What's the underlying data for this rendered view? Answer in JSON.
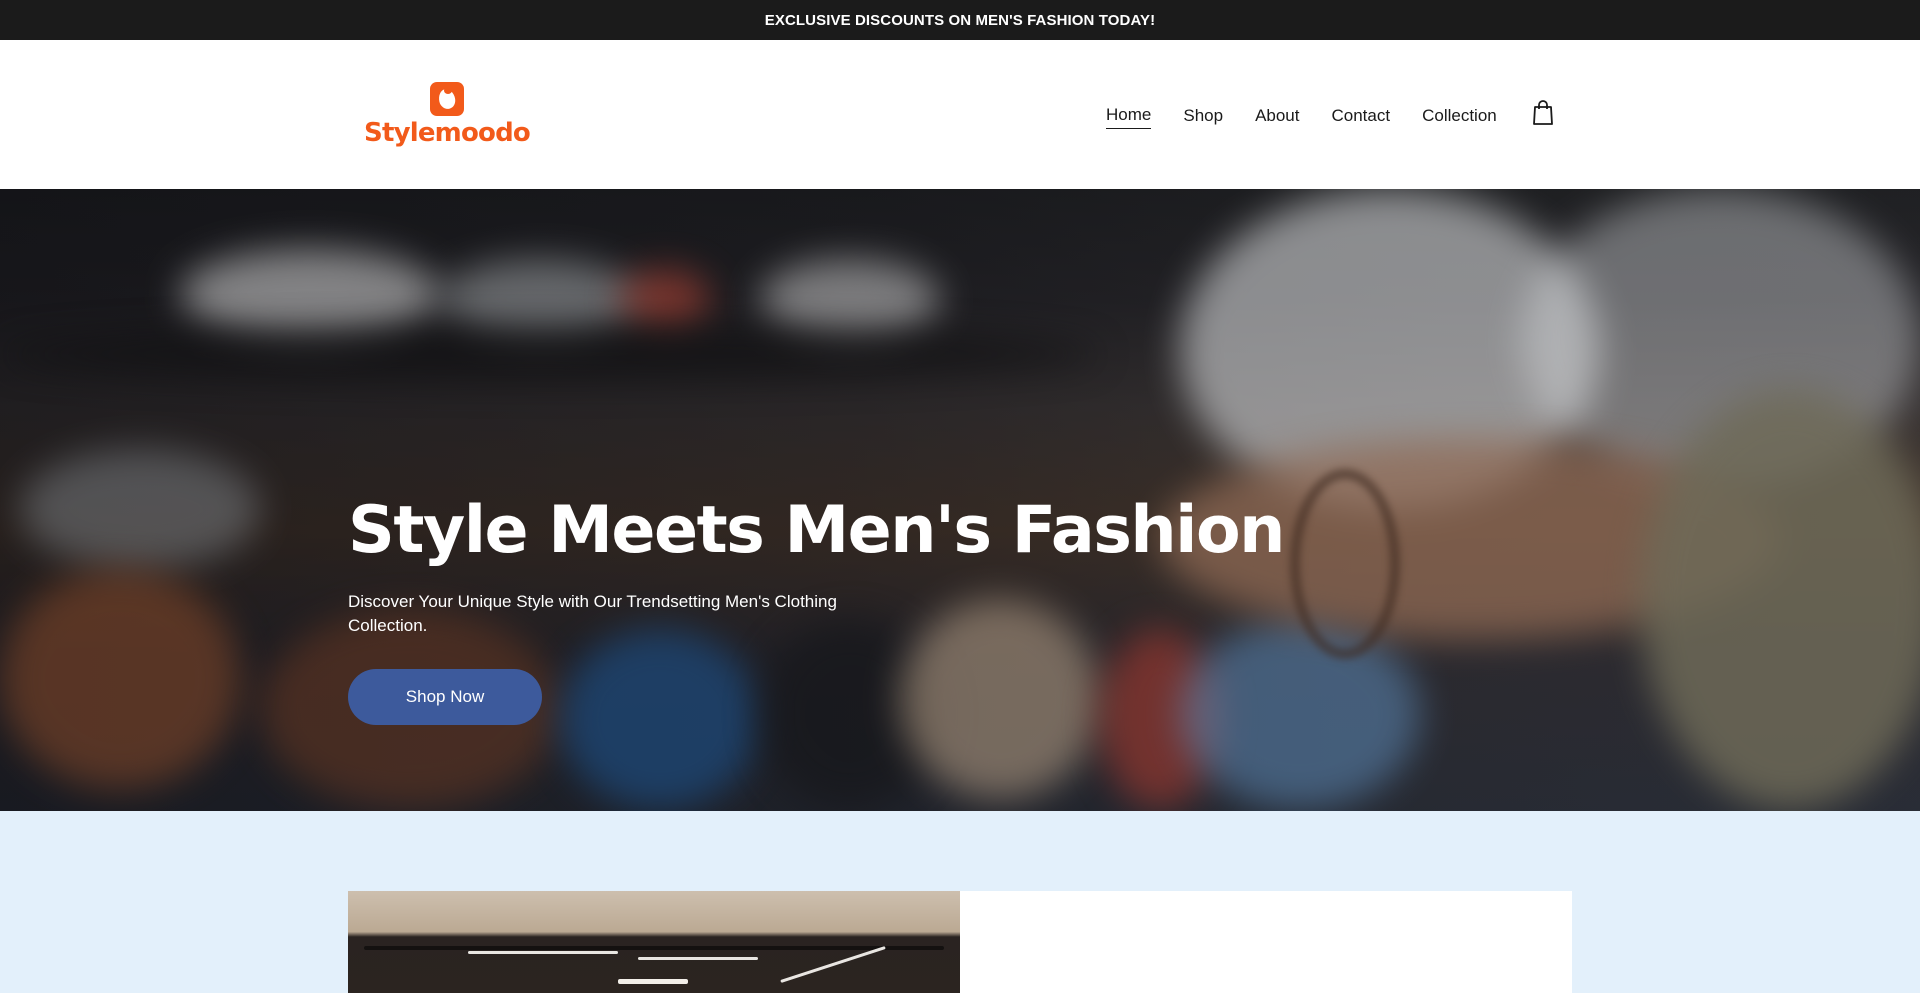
{
  "promo": {
    "text": "EXCLUSIVE DISCOUNTS ON MEN'S FASHION TODAY!"
  },
  "header": {
    "logo_text": "Stylemoodo",
    "brand_color": "#f25a1a",
    "nav": [
      {
        "label": "Home",
        "active": true
      },
      {
        "label": "Shop",
        "active": false
      },
      {
        "label": "About",
        "active": false
      },
      {
        "label": "Contact",
        "active": false
      },
      {
        "label": "Collection",
        "active": false
      }
    ],
    "cart_icon": "shopping-bag-icon"
  },
  "hero": {
    "title": "Style Meets Men's Fashion",
    "subtitle": "Discover Your Unique Style with Our Trendsetting Men's Clothing Collection.",
    "cta_label": "Shop Now",
    "cta_color": "#3d5a9c"
  },
  "lower": {
    "background_color": "#e3f0fb"
  }
}
